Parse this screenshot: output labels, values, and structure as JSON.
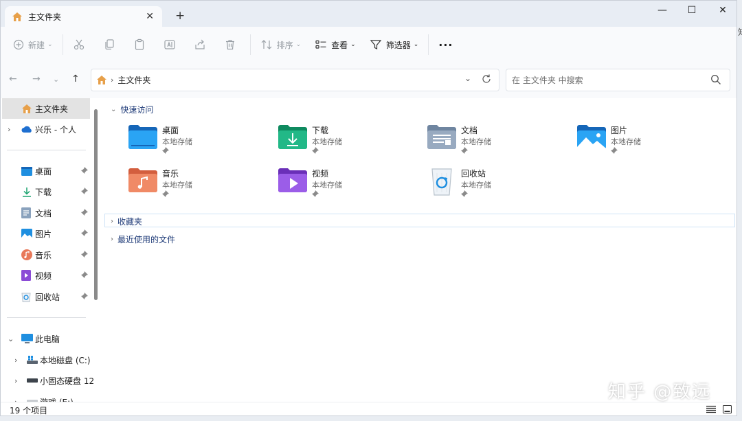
{
  "tab": {
    "title": "主文件夹",
    "close": "✕",
    "new": "+"
  },
  "window_controls": {
    "minimize": "—",
    "maximize": "☐",
    "close": "✕"
  },
  "toolbar": {
    "new_label": "新建",
    "sort_label": "排序",
    "view_label": "查看",
    "filter_label": "筛选器",
    "more_label": "···"
  },
  "address": {
    "crumb": "主文件夹"
  },
  "search": {
    "placeholder": "在 主文件夹 中搜索"
  },
  "sidebar": {
    "home": "主文件夹",
    "onedrive": "兴乐 - 个人",
    "pinned": [
      "桌面",
      "下载",
      "文档",
      "图片",
      "音乐",
      "视频",
      "回收站"
    ],
    "this_pc": "此电脑",
    "drives": [
      "本地磁盘 (C:)",
      "小固态硬盘 12",
      "游戏 (E:)"
    ]
  },
  "groups": {
    "quick_access": "快速访问",
    "favorites": "收藏夹",
    "recent": "最近使用的文件"
  },
  "quick_items": [
    {
      "name": "桌面",
      "sub": "本地存储"
    },
    {
      "name": "下载",
      "sub": "本地存储"
    },
    {
      "name": "文档",
      "sub": "本地存储"
    },
    {
      "name": "图片",
      "sub": "本地存储"
    },
    {
      "name": "音乐",
      "sub": "本地存储"
    },
    {
      "name": "视频",
      "sub": "本地存储"
    },
    {
      "name": "回收站",
      "sub": "本地存储"
    }
  ],
  "status": {
    "count": "19 个项目"
  },
  "watermark": "知乎 @致远",
  "edge_glyph": "知",
  "colors": {
    "accent": "#1f3b78",
    "titlebar": "#e8edf4",
    "selected": "#e3e3e3"
  }
}
